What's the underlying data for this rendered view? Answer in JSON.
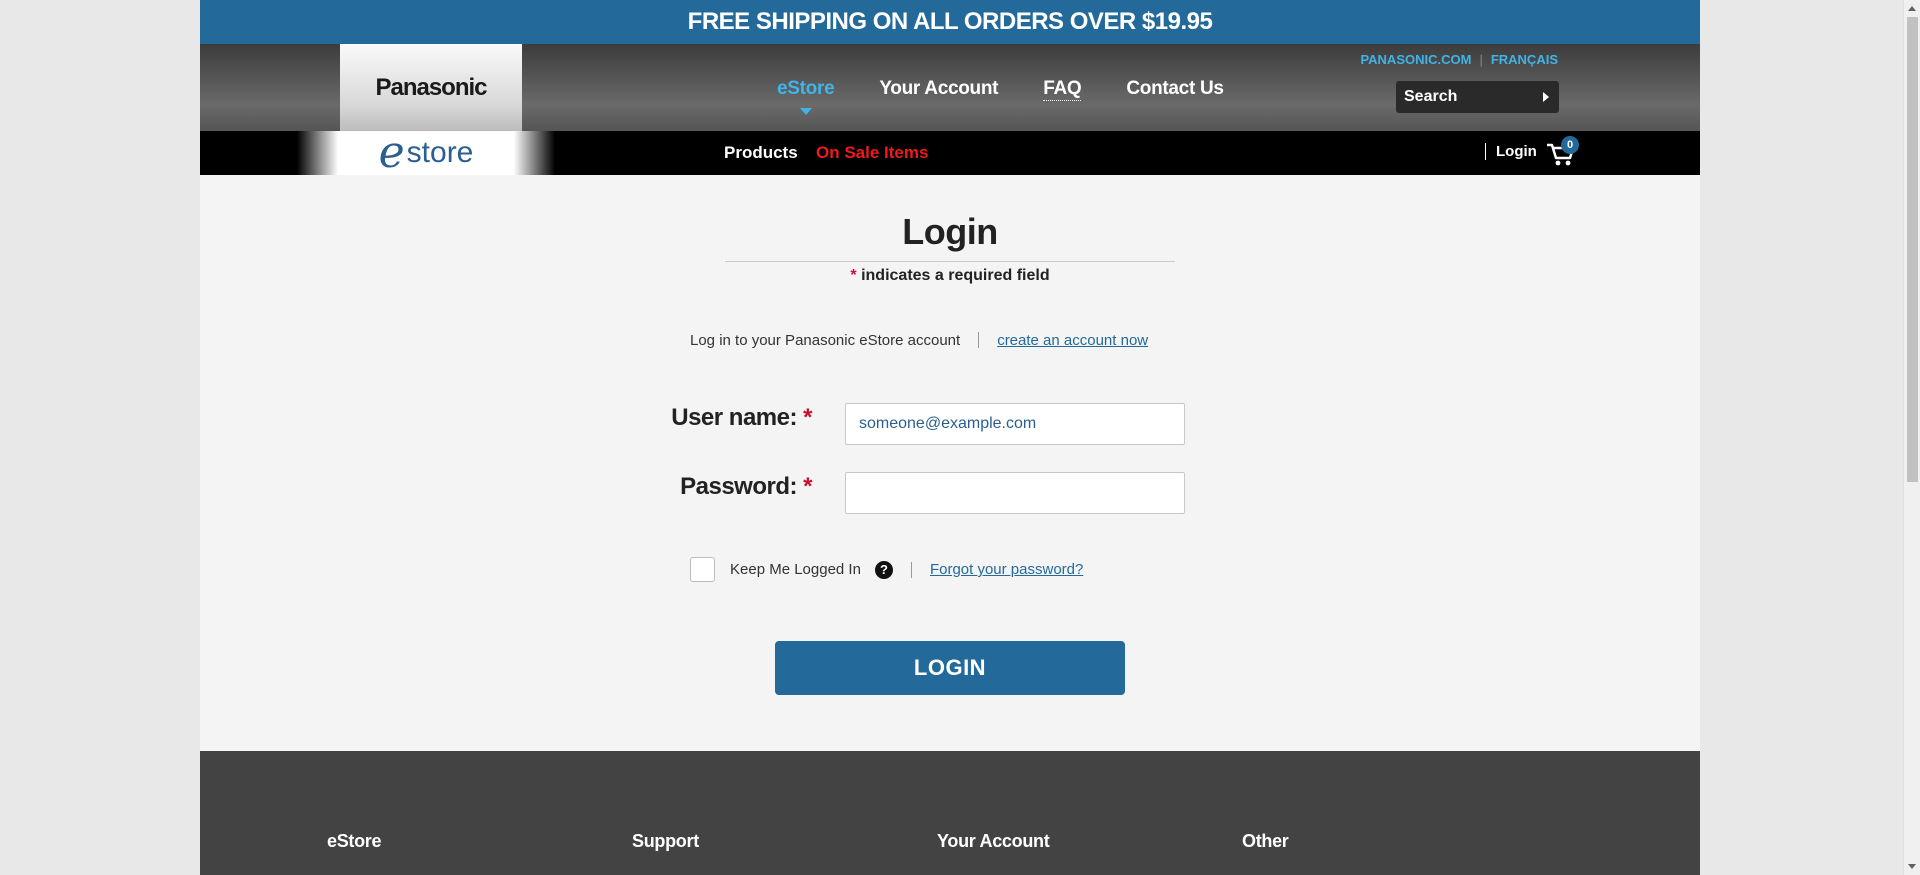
{
  "promo": {
    "text": "FREE SHIPPING ON ALL ORDERS OVER $19.95"
  },
  "header": {
    "brand": "Panasonic",
    "nav": [
      "eStore",
      "Your Account",
      "FAQ",
      "Contact Us"
    ],
    "active_nav": "eStore",
    "util_links": [
      "PANASONIC.COM",
      "FRANÇAIS"
    ],
    "search_label": "Search"
  },
  "subnav": {
    "estore_logo_e": "e",
    "estore_logo_store": "store",
    "products": "Products",
    "on_sale": "On Sale Items",
    "login": "Login",
    "cart_count": "0"
  },
  "login_form": {
    "title": "Login",
    "required_star": "*",
    "required_note": " indicates a required field",
    "intro_text": "Log in to your Panasonic eStore account",
    "create_account": "create an account now",
    "username_label": "User name:",
    "username_value": "someone@example.com",
    "password_label": "Password:",
    "password_value": "",
    "keep_logged_in": "Keep Me Logged In",
    "help_icon": "?",
    "forgot_password": "Forgot your password?",
    "login_button": "LOGIN"
  },
  "footer": {
    "columns": [
      "eStore",
      "Support",
      "Your Account",
      "Other"
    ]
  },
  "colors": {
    "brand_blue": "#236a9b",
    "accent_cyan": "#3fb4e8",
    "sale_red": "#f01a1a",
    "required_red": "#c8102e"
  }
}
